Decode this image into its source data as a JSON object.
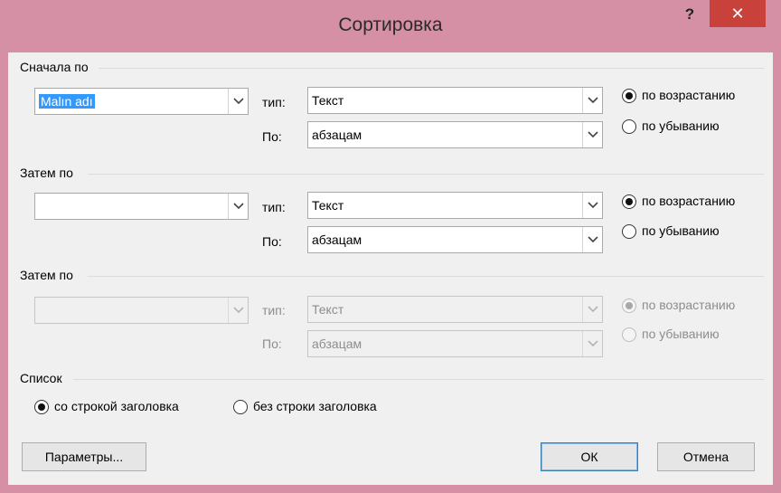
{
  "window": {
    "title": "Сортировка",
    "help_glyph": "?",
    "close_glyph": "✕"
  },
  "group1": {
    "title": "Сначала по",
    "field_value": "Malın adı",
    "type_label": "тип:",
    "type_value": "Текст",
    "by_label": "По:",
    "by_value": "абзацам",
    "asc_label": "по возрастанию",
    "desc_label": "по убыванию"
  },
  "group2": {
    "title": "Затем по",
    "field_value": "",
    "type_label": "тип:",
    "type_value": "Текст",
    "by_label": "По:",
    "by_value": "абзацам",
    "asc_label": "по возрастанию",
    "desc_label": "по убыванию"
  },
  "group3": {
    "title": "Затем по",
    "field_value": "",
    "type_label": "тип:",
    "type_value": "Текст",
    "by_label": "По:",
    "by_value": "абзацам",
    "asc_label": "по возрастанию",
    "desc_label": "по убыванию"
  },
  "list": {
    "title": "Список",
    "with_header_label": "со строкой заголовка",
    "without_header_label": "без строки заголовка"
  },
  "buttons": {
    "options": "Параметры...",
    "ok": "ОК",
    "cancel": "Отмена"
  },
  "colors": {
    "titlebar": "#d590a6",
    "close_button": "#c8413a",
    "selection": "#3399ff"
  },
  "icons": [
    "help-icon",
    "close-icon",
    "chevron-down-icon"
  ]
}
